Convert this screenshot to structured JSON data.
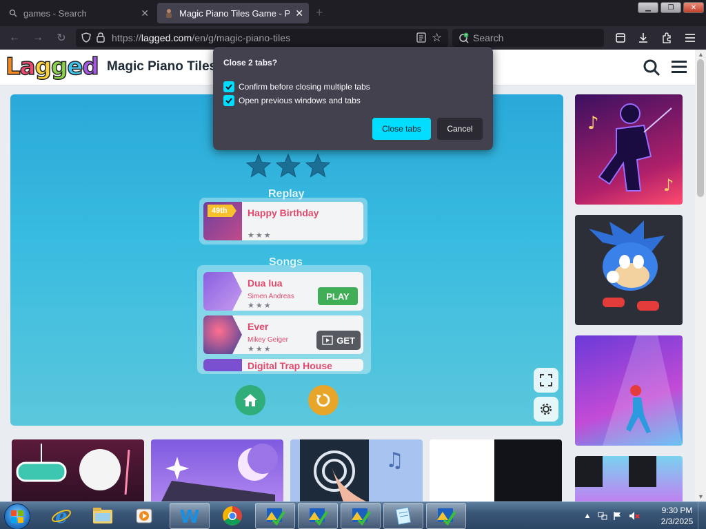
{
  "browser": {
    "tabs": [
      {
        "title": "games - Search",
        "active": false
      },
      {
        "title": "Magic Piano Tiles Game - Play",
        "active": true
      }
    ],
    "url": {
      "scheme": "https://",
      "domain": "lagged.com",
      "path": "/en/g/magic-piano-tiles"
    },
    "search_placeholder": "Search"
  },
  "site": {
    "logo_letters": [
      "L",
      "a",
      "g",
      "g",
      "e",
      "d"
    ],
    "logo_colors": [
      "#f48a1f",
      "#ef4a6f",
      "#ffd23a",
      "#8bd14b",
      "#41c6ef",
      "#a45ae0"
    ],
    "title": "Magic Piano Tiles"
  },
  "game": {
    "stars_earned": 3,
    "replay_title": "Replay",
    "replay_song": {
      "rank": "49th",
      "name": "Happy Birthday",
      "stars": "★★★"
    },
    "songs_title": "Songs",
    "songs": [
      {
        "name": "Dua lua",
        "artist": "Simen Andreas",
        "stars": "★★★",
        "action": "PLAY"
      },
      {
        "name": "Ever",
        "artist": "Mikey Geiger",
        "stars": "★★★",
        "action": "GET"
      },
      {
        "name": "Digital Trap House",
        "artist": "",
        "stars": "",
        "action": ""
      }
    ]
  },
  "dialog": {
    "title": "Close 2 tabs?",
    "checkboxes": [
      {
        "label": "Confirm before closing multiple tabs",
        "checked": true
      },
      {
        "label": "Open previous windows and tabs",
        "checked": true
      }
    ],
    "primary_button": "Close tabs",
    "secondary_button": "Cancel"
  },
  "taskbar": {
    "clock_time": "9:30 PM",
    "clock_date": "2/3/2025"
  },
  "colors": {
    "dialog_bg": "#42414d",
    "accent": "#00ddff",
    "game_bg": "#33b5dd"
  }
}
